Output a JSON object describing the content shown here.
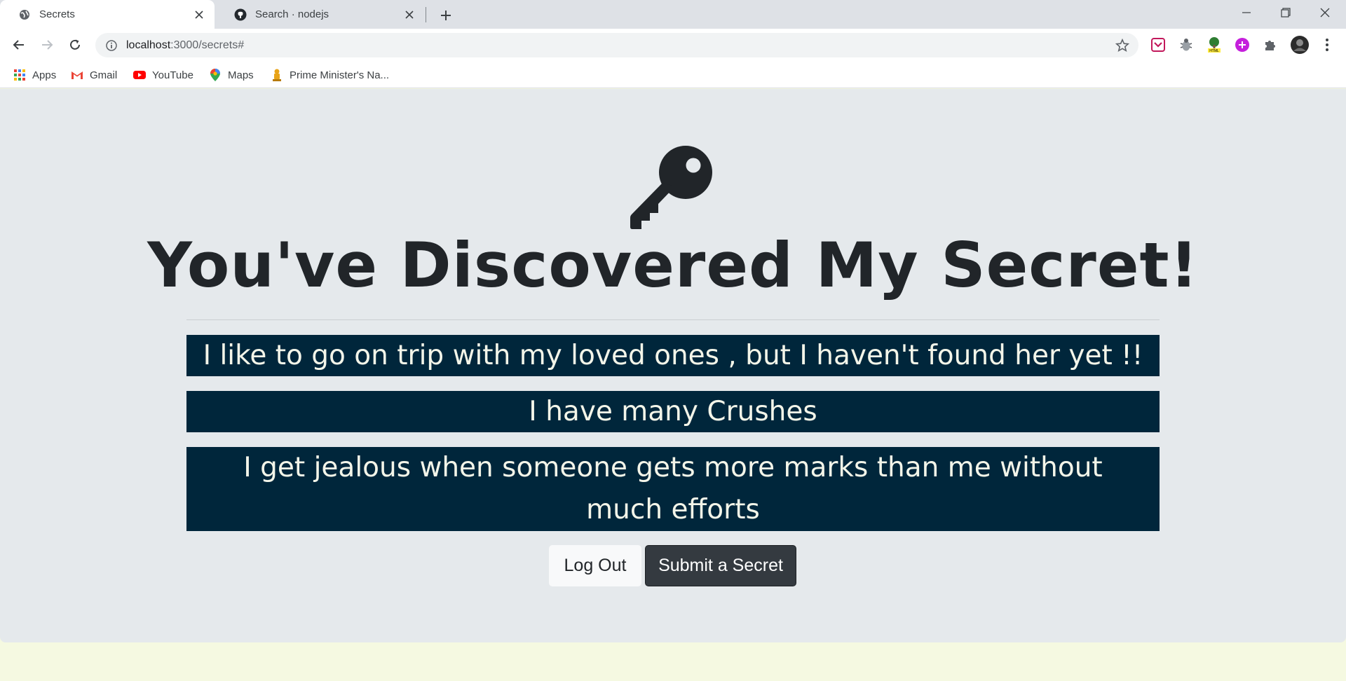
{
  "browser": {
    "tabs": [
      {
        "title": "Secrets",
        "icon": "globe-icon"
      },
      {
        "title": "Search · nodejs",
        "icon": "github-icon"
      }
    ],
    "address": {
      "host": "localhost",
      "path": ":3000/secrets#"
    },
    "bookmarks": [
      {
        "label": "Apps",
        "icon": "apps-grid-icon"
      },
      {
        "label": "Gmail",
        "icon": "gmail-icon"
      },
      {
        "label": "YouTube",
        "icon": "youtube-icon"
      },
      {
        "label": "Maps",
        "icon": "maps-icon"
      },
      {
        "label": "Prime Minister's Na...",
        "icon": "emblem-icon"
      }
    ],
    "extensions": [
      "pocket-icon",
      "bug-icon",
      "tree-icon",
      "purple-ext-icon",
      "puzzle-icon",
      "profile-avatar"
    ]
  },
  "page": {
    "heading": "You've Discovered My Secret!",
    "secrets": [
      "I like to go on trip with my loved ones , but I haven't found her yet !!",
      "I have many Crushes",
      "I get jealous when someone gets more marks than me without much efforts"
    ],
    "logout_label": "Log Out",
    "submit_label": "Submit a Secret"
  },
  "colors": {
    "page_bg": "#e5e9ec",
    "secret_bg": "#00263b",
    "secret_text": "#f3f5e9",
    "dark_button": "#343a40",
    "light_button": "#f8f9fa"
  }
}
